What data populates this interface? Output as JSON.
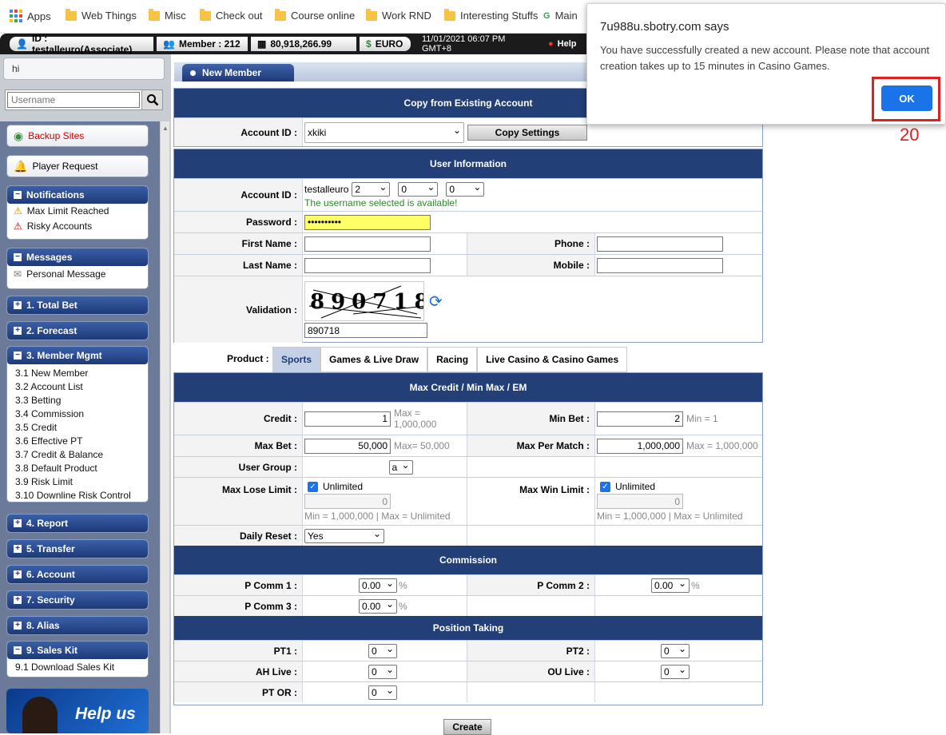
{
  "bookmarks": {
    "items": [
      "Apps",
      "Web Things",
      "Misc",
      "Check out",
      "Course online",
      "Work RND",
      "Interesting Stuffs",
      "Main"
    ]
  },
  "infobar": {
    "account": "ID : testalleuro(Associate)",
    "member": "Member : 212",
    "balance": "80,918,266.99",
    "currency": "EURO",
    "datetime": "11/01/2021 06:07 PM GMT+8",
    "help": "Help"
  },
  "sidebar": {
    "greeting": "hi",
    "search_placeholder": "Username",
    "backup_sites": "Backup Sites",
    "player_request": "Player Request",
    "notifications": {
      "title": "Notifications",
      "items": [
        "Max Limit Reached",
        "Risky Accounts"
      ]
    },
    "messages": {
      "title": "Messages",
      "items": [
        "Personal Message"
      ]
    },
    "sections": {
      "total_bet": "1. Total Bet",
      "forecast": "2. Forecast",
      "member_mgmt": "3. Member Mgmt",
      "report": "4. Report",
      "transfer": "5. Transfer",
      "account": "6. Account",
      "security": "7. Security",
      "alias": "8. Alias",
      "sales_kit": "9. Sales Kit"
    },
    "member_items": [
      "3.1 New Member",
      "3.2 Account List",
      "3.3 Betting",
      "3.4 Commission",
      "3.5 Credit",
      "3.6 Effective PT",
      "3.7 Credit & Balance",
      "3.8 Default Product",
      "3.9 Risk Limit",
      "3.10 Downline Risk Control"
    ],
    "sales_items": [
      "9.1 Download Sales Kit"
    ],
    "banner_text": "Help us"
  },
  "page": {
    "tab_title": "New Member",
    "copy": {
      "header": "Copy from Existing Account",
      "account_label": "Account ID :",
      "account_value": "xkiki",
      "copy_button": "Copy Settings"
    },
    "user_info": {
      "header": "User Information",
      "account_label": "Account ID :",
      "account_prefix": "testalleuro",
      "sel1": "2",
      "sel2": "0",
      "sel3": "0",
      "available_msg": "The username selected is available!",
      "password_label": "Password :",
      "password_value": "••••••••••",
      "first_name_label": "First Name :",
      "phone_label": "Phone :",
      "last_name_label": "Last Name :",
      "mobile_label": "Mobile :",
      "validation_label": "Validation :",
      "captcha_text": "890718",
      "validation_value": "890718"
    },
    "product": {
      "label": "Product :",
      "tabs": [
        "Sports",
        "Games & Live Draw",
        "Racing",
        "Live Casino & Casino Games"
      ]
    },
    "max_credit": {
      "header": "Max Credit / Min Max / EM",
      "credit_label": "Credit :",
      "credit_value": "1",
      "credit_note": "Max = 1,000,000",
      "min_bet_label": "Min Bet :",
      "min_bet_value": "2",
      "min_bet_note": "Min = 1",
      "max_bet_label": "Max Bet :",
      "max_bet_value": "50,000",
      "max_bet_note": "Max= 50,000",
      "max_per_match_label": "Max Per Match :",
      "max_per_match_value": "1,000,000",
      "max_per_match_note": "Max = 1,000,000",
      "user_group_label": "User Group :",
      "user_group_value": "a",
      "max_lose_label": "Max Lose Limit :",
      "max_win_label": "Max Win Limit :",
      "unlimited": "Unlimited",
      "lose_value": "0",
      "win_value": "0",
      "limit_note_min": "Min = 1,000,000",
      "limit_note_sep": "|",
      "limit_note_max": "Max = Unlimited",
      "daily_reset_label": "Daily Reset :",
      "daily_reset_value": "Yes"
    },
    "commission": {
      "header": "Commission",
      "p1_label": "P Comm 1 :",
      "p1_value": "0.00",
      "p2_label": "P Comm 2 :",
      "p2_value": "0.00",
      "p3_label": "P Comm 3 :",
      "p3_value": "0.00",
      "pct": "%"
    },
    "position": {
      "header": "Position Taking",
      "pt1_label": "PT1 :",
      "pt1_value": "0",
      "pt2_label": "PT2 :",
      "pt2_value": "0",
      "ah_label": "AH Live :",
      "ah_value": "0",
      "ou_label": "OU Live :",
      "ou_value": "0",
      "ptor_label": "PT OR :",
      "ptor_value": "0"
    },
    "create_button": "Create"
  },
  "dialog": {
    "title": "7u988u.sbotry.com says",
    "message": "You have successfully created a new account. Please note that account creation takes up to 15 minutes in Casino Games.",
    "ok": "OK"
  },
  "annotation": {
    "label": "20",
    "color": "#e02020"
  },
  "colors": {
    "header_navy": "#223f78",
    "sidebar_blue": "#1d3a78",
    "dialog_button": "#1a73e8",
    "password_bg": "#ffff66"
  }
}
